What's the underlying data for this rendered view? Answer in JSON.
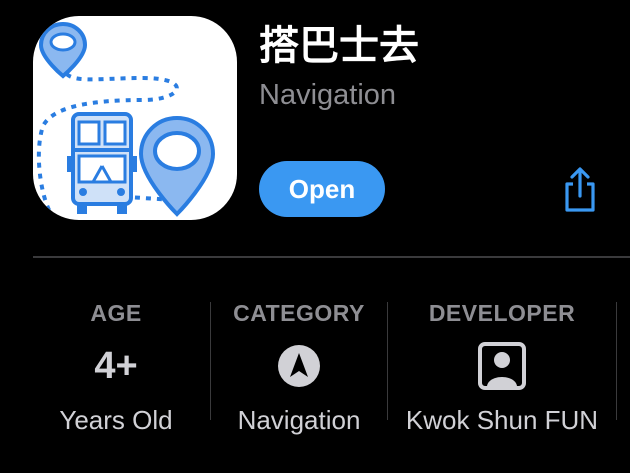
{
  "app": {
    "name": "搭巴士去",
    "subtitle": "Navigation",
    "icon": "bus-map-pin-app-icon"
  },
  "actions": {
    "open_label": "Open",
    "share_icon": "share-icon"
  },
  "info": {
    "age": {
      "label": "AGE",
      "value": "4+",
      "sub": "Years Old"
    },
    "category": {
      "label": "CATEGORY",
      "icon": "compass-navigation-icon",
      "sub": "Navigation"
    },
    "developer": {
      "label": "DEVELOPER",
      "icon": "person-square-icon",
      "sub": "Kwok Shun FUN"
    }
  },
  "colors": {
    "accent": "#3a98f2",
    "background": "#000000",
    "secondary_text": "#8e8e93",
    "divider": "#3a3a3c"
  }
}
